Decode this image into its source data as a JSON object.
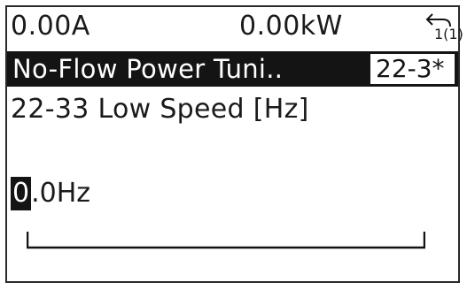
{
  "status": {
    "readout_1": "0.00A",
    "readout_2": "0.00kW",
    "menu_number": "1(1)",
    "menu_icon": "menu-return-icon"
  },
  "header": {
    "title": "No-Flow Power Tuni..",
    "param_group": "22-3*"
  },
  "parameter": {
    "name": "22-33 Low Speed [Hz]",
    "value_cursor_digit": "0",
    "value_rest": ".0Hz"
  },
  "colors": {
    "display_bg": "#ffffff",
    "foreground": "#141414",
    "inverse_text": "#ffffff"
  }
}
